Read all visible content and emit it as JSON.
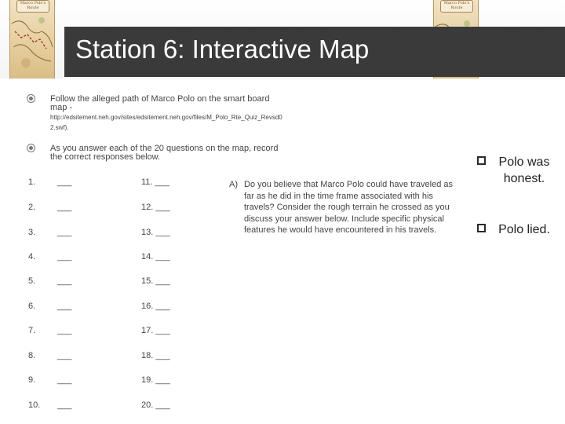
{
  "slide": {
    "title": "Station 6: Interactive Map",
    "map_image_label": "Marco Polo's Route"
  },
  "instructions": [
    "Follow the alleged path of Marco Polo on the smart board map -",
    "As you answer each of the 20 questions on the map, record the correct responses below."
  ],
  "url": "http://edsitement.neh.gov/sites/edsitement.neh.gov/files/M_Polo_Rte_Quiz_Revsd02.swf).",
  "answers_left": [
    {
      "num": "1.",
      "blank": "___"
    },
    {
      "num": "2.",
      "blank": "___"
    },
    {
      "num": "3.",
      "blank": "___"
    },
    {
      "num": "4.",
      "blank": "___"
    },
    {
      "num": "5.",
      "blank": "___"
    },
    {
      "num": "6.",
      "blank": "___"
    },
    {
      "num": "7.",
      "blank": "___"
    },
    {
      "num": "8.",
      "blank": "___"
    },
    {
      "num": "9.",
      "blank": "___"
    },
    {
      "num": "10.",
      "blank": "___"
    }
  ],
  "answers_right": [
    "11. ___",
    "12. ___",
    "13. ___",
    "14. ___",
    "15. ___",
    "16. ___",
    "17. ___",
    "18. ___",
    "19. ___",
    "20. ___"
  ],
  "question": {
    "letter": "A)",
    "text": "Do you believe that Marco Polo could have traveled as far as he did in the time frame associated with his travels? Consider the rough terrain he crossed as you discuss your answer below. Include specific physical features he would have encountered in his travels."
  },
  "choices": [
    "Polo was honest.",
    "Polo lied."
  ]
}
